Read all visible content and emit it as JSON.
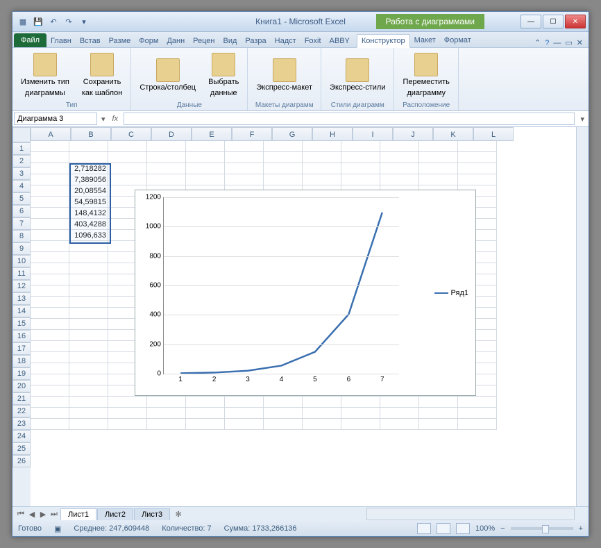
{
  "titlebar": {
    "doc": "Книга1",
    "app": "Microsoft Excel",
    "chart_context": "Работа с диаграммами"
  },
  "tabs": {
    "file": "Файл",
    "items": [
      "Главн",
      "Встав",
      "Разме",
      "Форм",
      "Данн",
      "Рецен",
      "Вид",
      "Разра",
      "Надст",
      "Foxit",
      "ABBY"
    ],
    "chart_tabs": [
      "Конструктор",
      "Макет",
      "Формат"
    ]
  },
  "ribbon": {
    "groups": [
      {
        "label": "Тип",
        "buttons": [
          {
            "t1": "Изменить тип",
            "t2": "диаграммы"
          },
          {
            "t1": "Сохранить",
            "t2": "как шаблон"
          }
        ]
      },
      {
        "label": "Данные",
        "buttons": [
          {
            "t1": "Строка/столбец",
            "t2": ""
          },
          {
            "t1": "Выбрать",
            "t2": "данные"
          }
        ]
      },
      {
        "label": "Макеты диаграмм",
        "buttons": [
          {
            "t1": "Экспресс-макет",
            "t2": ""
          }
        ]
      },
      {
        "label": "Стили диаграмм",
        "buttons": [
          {
            "t1": "Экспресс-стили",
            "t2": ""
          }
        ]
      },
      {
        "label": "Расположение",
        "buttons": [
          {
            "t1": "Переместить",
            "t2": "диаграмму"
          }
        ]
      }
    ]
  },
  "namebox": "Диаграмма 3",
  "columns": [
    "A",
    "B",
    "C",
    "D",
    "E",
    "F",
    "G",
    "H",
    "I",
    "J",
    "K",
    "L"
  ],
  "row_count": 26,
  "data_cells": {
    "col": "B",
    "start_row": 3,
    "values": [
      "2,718282",
      "7,389056",
      "20,08554",
      "54,59815",
      "148,4132",
      "403,4288",
      "1096,633"
    ]
  },
  "sheets": [
    "Лист1",
    "Лист2",
    "Лист3"
  ],
  "status": {
    "ready": "Готово",
    "avg_label": "Среднее:",
    "avg": "247,609448",
    "count_label": "Количество:",
    "count": "7",
    "sum_label": "Сумма:",
    "sum": "1733,266136",
    "zoom": "100%"
  },
  "chart_data": {
    "type": "line",
    "categories": [
      1,
      2,
      3,
      4,
      5,
      6,
      7
    ],
    "series": [
      {
        "name": "Ряд1",
        "values": [
          2.718282,
          7.389056,
          20.08554,
          54.59815,
          148.4132,
          403.4288,
          1096.633
        ]
      }
    ],
    "ylim": [
      0,
      1200
    ],
    "yticks": [
      0,
      200,
      400,
      600,
      800,
      1000,
      1200
    ]
  }
}
